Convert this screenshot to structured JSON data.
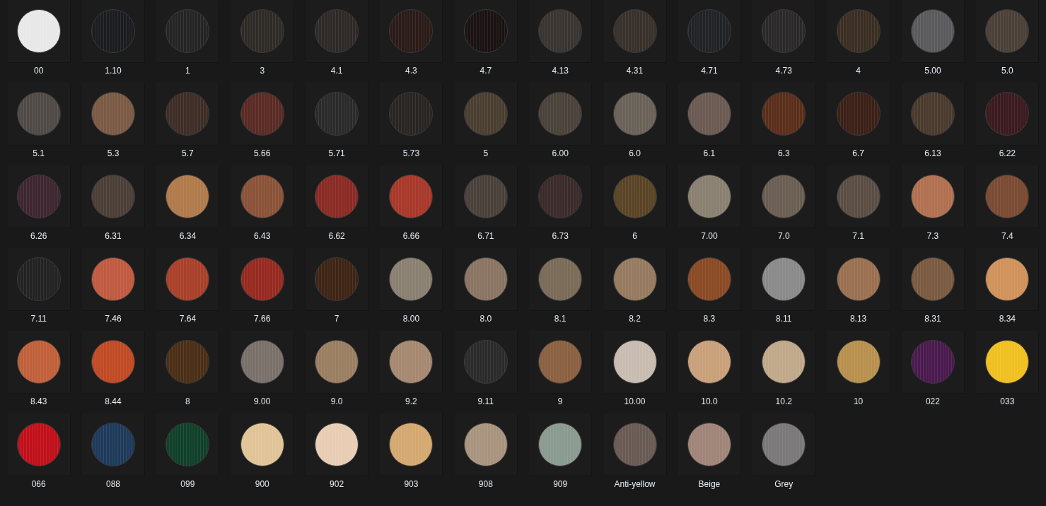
{
  "items": [
    {
      "label": "00",
      "color": "#e8e8e8"
    },
    {
      "label": "1.10",
      "color": "#1a1c20"
    },
    {
      "label": "1",
      "color": "#242424"
    },
    {
      "label": "3",
      "color": "#2e2a26"
    },
    {
      "label": "4.1",
      "color": "#2e2826"
    },
    {
      "label": "4.3",
      "color": "#2a1a18"
    },
    {
      "label": "4.7",
      "color": "#1a1212"
    },
    {
      "label": "4.13",
      "color": "#3a3430"
    },
    {
      "label": "4.31",
      "color": "#38302a"
    },
    {
      "label": "4.71",
      "color": "#202226"
    },
    {
      "label": "4.73",
      "color": "#2a2828"
    },
    {
      "label": "4",
      "color": "#3a2e22"
    },
    {
      "label": "5.00",
      "color": "#5a5a5c"
    },
    {
      "label": "5.0",
      "color": "#4a4038"
    },
    {
      "label": "5.1",
      "color": "#504a46"
    },
    {
      "label": "5.3",
      "color": "#7a5a44"
    },
    {
      "label": "5.7",
      "color": "#3e2c26"
    },
    {
      "label": "5.66",
      "color": "#5a2a24"
    },
    {
      "label": "5.71",
      "color": "#2a2a2a"
    },
    {
      "label": "5.73",
      "color": "#282422"
    },
    {
      "label": "5",
      "color": "#4a3e30"
    },
    {
      "label": "6.00",
      "color": "#4a423a"
    },
    {
      "label": "6.0",
      "color": "#6a6258"
    },
    {
      "label": "6.1",
      "color": "#6a5a52"
    },
    {
      "label": "6.3",
      "color": "#5a2e1a"
    },
    {
      "label": "6.7",
      "color": "#3a2016"
    },
    {
      "label": "6.13",
      "color": "#4a3a2e"
    },
    {
      "label": "6.22",
      "color": "#3a1a1e"
    },
    {
      "label": "6.26",
      "color": "#3e2630"
    },
    {
      "label": "6.31",
      "color": "#4a3e36"
    },
    {
      "label": "6.34",
      "color": "#b07a4a"
    },
    {
      "label": "6.43",
      "color": "#8a5238"
    },
    {
      "label": "6.62",
      "color": "#8a2a24"
    },
    {
      "label": "6.66",
      "color": "#a8382a"
    },
    {
      "label": "6.71",
      "color": "#4a403a"
    },
    {
      "label": "6.73",
      "color": "#3a2a2a"
    },
    {
      "label": "6",
      "color": "#5a4426"
    },
    {
      "label": "7.00",
      "color": "#8a8070"
    },
    {
      "label": "7.0",
      "color": "#6a5e52"
    },
    {
      "label": "7.1",
      "color": "#5a4e44"
    },
    {
      "label": "7.3",
      "color": "#b07050"
    },
    {
      "label": "7.4",
      "color": "#7a4a32"
    },
    {
      "label": "7.11",
      "color": "#222222"
    },
    {
      "label": "7.46",
      "color": "#c05a40"
    },
    {
      "label": "7.64",
      "color": "#a8402a"
    },
    {
      "label": "7.66",
      "color": "#962a20"
    },
    {
      "label": "7",
      "color": "#3e2414"
    },
    {
      "label": "8.00",
      "color": "#8a8071"
    },
    {
      "label": "8.0",
      "color": "#8a7462"
    },
    {
      "label": "8.1",
      "color": "#7a6a58"
    },
    {
      "label": "8.2",
      "color": "#967a60"
    },
    {
      "label": "8.3",
      "color": "#8a4a24"
    },
    {
      "label": "8.11",
      "color": "#8a8a8a"
    },
    {
      "label": "8.13",
      "color": "#9a7050"
    },
    {
      "label": "8.31",
      "color": "#7a5a40"
    },
    {
      "label": "8.34",
      "color": "#d0925a"
    },
    {
      "label": "8.43",
      "color": "#c0603a"
    },
    {
      "label": "8.44",
      "color": "#c04a24"
    },
    {
      "label": "8",
      "color": "#4a2e16"
    },
    {
      "label": "9.00",
      "color": "#7a706a"
    },
    {
      "label": "9.0",
      "color": "#9a7e62"
    },
    {
      "label": "9.2",
      "color": "#a68870"
    },
    {
      "label": "9.11",
      "color": "#2a2a2b"
    },
    {
      "label": "9",
      "color": "#8a6040"
    },
    {
      "label": "10.00",
      "color": "#c8bcb0"
    },
    {
      "label": "10.0",
      "color": "#c8a07a"
    },
    {
      "label": "10.2",
      "color": "#c0a88a"
    },
    {
      "label": "10",
      "color": "#b8904e"
    },
    {
      "label": "022",
      "color": "#4a1a4e"
    },
    {
      "label": "033",
      "color": "#f0c020"
    },
    {
      "label": "066",
      "color": "#c0101a"
    },
    {
      "label": "088",
      "color": "#1e3a5a"
    },
    {
      "label": "099",
      "color": "#10402a"
    },
    {
      "label": "900",
      "color": "#e0c498"
    },
    {
      "label": "902",
      "color": "#e8ccb4"
    },
    {
      "label": "903",
      "color": "#d4a870"
    },
    {
      "label": "908",
      "color": "#a8947e"
    },
    {
      "label": "909",
      "color": "#8a9a90"
    },
    {
      "label": "Anti-yellow",
      "color": "#6a5a54"
    },
    {
      "label": "Beige",
      "color": "#a08478"
    },
    {
      "label": "Grey",
      "color": "#7a7878"
    }
  ]
}
